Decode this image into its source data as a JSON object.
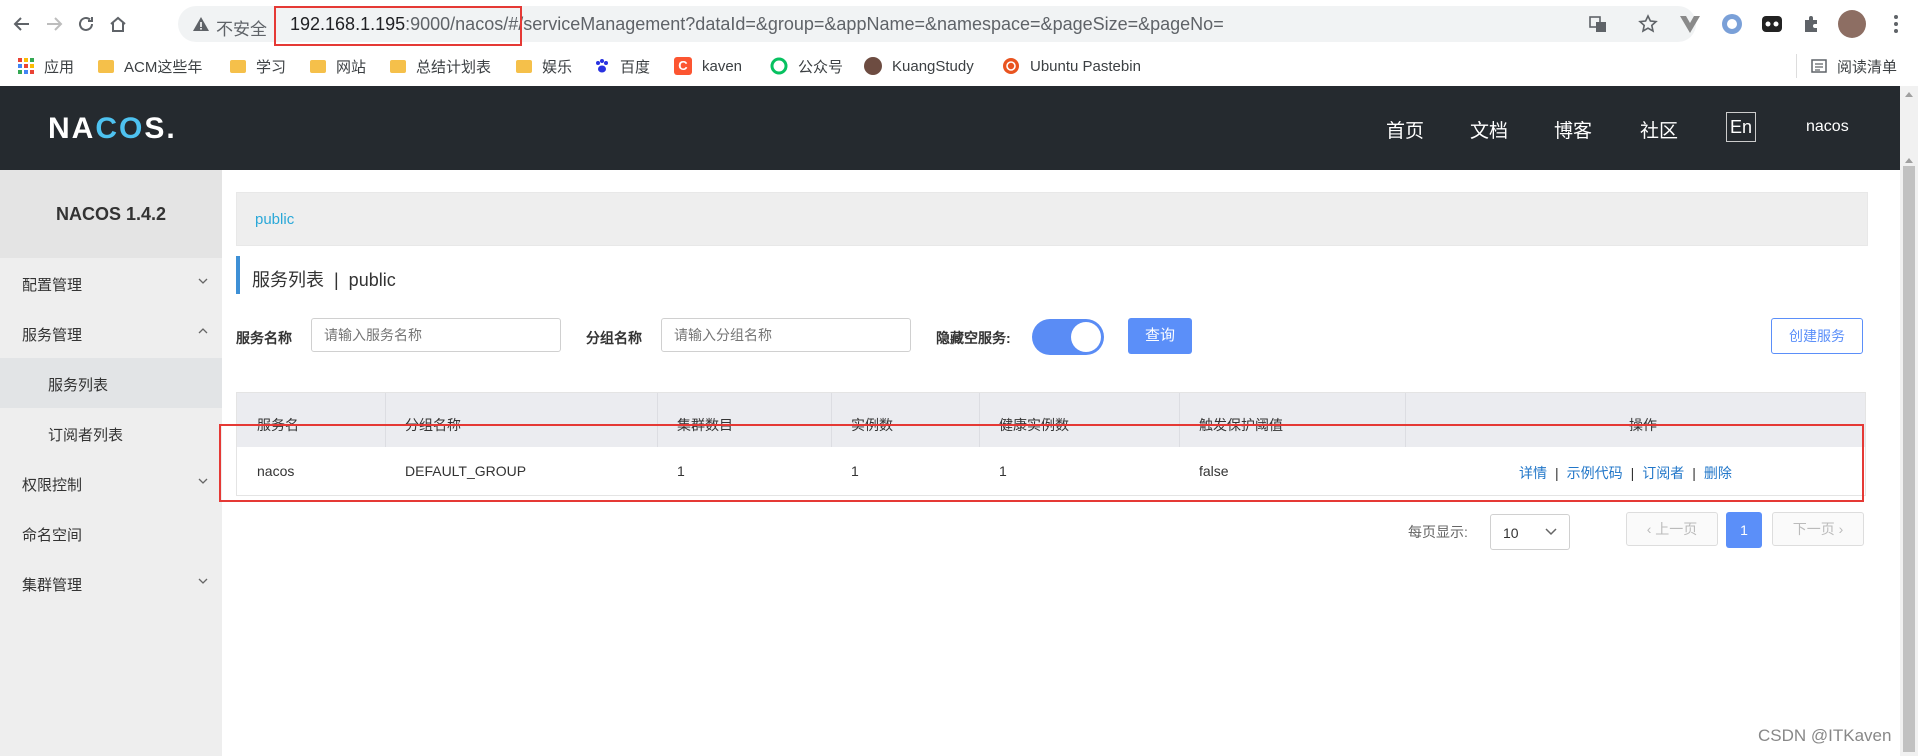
{
  "browser": {
    "insecure_label": "不安全",
    "url_host": "192.168.1.195",
    "url_rest": ":9000/nacos/#/serviceManagement?dataId=&group=&appName=&namespace=&pageSize=&pageNo=",
    "bookmarks": [
      "应用",
      "ACM这些年",
      "学习",
      "网站",
      "总结计划表",
      "娱乐",
      "百度",
      "kaven",
      "公众号",
      "KuangStudy",
      "Ubuntu Pastebin"
    ],
    "reading_list": "阅读清单"
  },
  "header": {
    "logo_pre": "NA",
    "logo_co": "CO",
    "logo_post": "S.",
    "nav": [
      "首页",
      "文档",
      "博客",
      "社区"
    ],
    "lang": "En",
    "user": "nacos"
  },
  "sidebar": {
    "title": "NACOS 1.4.2",
    "items": [
      "配置管理",
      "服务管理",
      "服务列表",
      "订阅者列表",
      "权限控制",
      "命名空间",
      "集群管理"
    ]
  },
  "main": {
    "namespace": "public",
    "title": "服务列表  |  public",
    "search": {
      "service_label": "服务名称",
      "service_placeholder": "请输入服务名称",
      "group_label": "分组名称",
      "group_placeholder": "请输入分组名称",
      "hide_empty_label": "隐藏空服务:",
      "hide_empty_enabled": true,
      "query_button": "查询",
      "create_button": "创建服务"
    },
    "table": {
      "headers": [
        "服务名",
        "分组名称",
        "集群数目",
        "实例数",
        "健康实例数",
        "触发保护阈值",
        "操作"
      ],
      "rows": [
        {
          "name": "nacos",
          "group": "DEFAULT_GROUP",
          "clusters": "1",
          "instances": "1",
          "healthy": "1",
          "threshold": "false"
        }
      ],
      "ops": [
        "详情",
        "示例代码",
        "订阅者",
        "删除"
      ]
    },
    "pagination": {
      "per_page_label": "每页显示:",
      "per_page": "10",
      "prev": "上一页",
      "next": "下一页",
      "current": "1"
    }
  },
  "watermark": "CSDN @ITKaven",
  "colors": {
    "accent": "#5b8ff9",
    "header_bg": "#252a2f",
    "highlight": "#e53935"
  }
}
